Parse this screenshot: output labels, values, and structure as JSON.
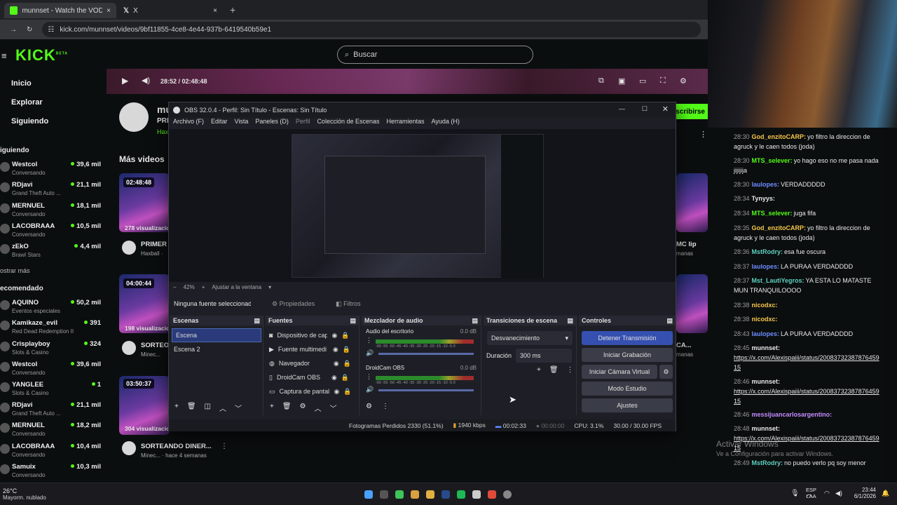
{
  "browser": {
    "tabs": [
      {
        "title": "munnset - Watch the VOD on k"
      },
      {
        "title": "X"
      }
    ],
    "url": "kick.com/munnset/videos/9bf11855-4ce8-4e44-937b-6419540b59e1"
  },
  "site": {
    "logo": "KICK",
    "logo_sup": "BETA",
    "search_placeholder": "Buscar",
    "nav": [
      {
        "label": "Inicio"
      },
      {
        "label": "Explorar"
      },
      {
        "label": "Siguiendo"
      }
    ],
    "following_header": "iguiendo",
    "show_more": "ostrar más",
    "recommended_header": "ecomendado",
    "following": [
      {
        "name": "Westcol",
        "category": "Conversando",
        "viewers": "39,6 mil"
      },
      {
        "name": "RDjavi",
        "category": "Grand Theft Auto ...",
        "viewers": "21,1 mil"
      },
      {
        "name": "MERNUEL",
        "category": "Conversando",
        "viewers": "18,1 mil"
      },
      {
        "name": "LACOBRAAA",
        "category": "Conversando",
        "viewers": "10,5 mil"
      },
      {
        "name": "zEkO",
        "category": "Brawl Stars",
        "viewers": "4,4 mil"
      }
    ],
    "recommended": [
      {
        "name": "AQUINO",
        "category": "Eventos especiales",
        "viewers": "50,2 mil"
      },
      {
        "name": "Kamikaze_evil",
        "category": "Red Dead Redemption II",
        "viewers": "391"
      },
      {
        "name": "Crisplayboy",
        "category": "Slots & Casino",
        "viewers": "324"
      },
      {
        "name": "Westcol",
        "category": "Conversando",
        "viewers": "39,6 mil"
      },
      {
        "name": "YANGLEE",
        "category": "Slots & Casino",
        "viewers": "1"
      },
      {
        "name": "RDjavi",
        "category": "Grand Theft Auto ...",
        "viewers": "21,1 mil"
      },
      {
        "name": "MERNUEL",
        "category": "Conversando",
        "viewers": "18,2 mil"
      },
      {
        "name": "LACOBRAAA",
        "category": "Conversando",
        "viewers": "10,4 mil"
      },
      {
        "name": "Samuix",
        "category": "Conversando",
        "viewers": "10,3 mil"
      }
    ],
    "player_time": "28:52 / 02:48:48",
    "channel_short": "mu",
    "channel_line2": "PRI",
    "channel_line3": "Hax",
    "subscribe_label": "scribirse",
    "more_videos": "Más videos",
    "videos": [
      {
        "duration": "02:48:48",
        "views": "278 visualizacio",
        "title": "PRIMER S",
        "meta": "Haxball ·"
      },
      {
        "duration": "04:00:44",
        "views": "198 visualizacio",
        "title": "SORTEO",
        "meta": "Minec..."
      },
      {
        "duration": "03:50:37",
        "views": "304 visualizacio",
        "title": "SORTEANDO DINER...",
        "meta": "Minec... · hace 4 semanas"
      }
    ],
    "right_thumbs": [
      {
        "title": "MC lip",
        "meta": "manas"
      },
      {
        "title": "CA...",
        "meta": "manas"
      }
    ]
  },
  "chat": {
    "messages": [
      {
        "time": "28:30",
        "user": "God_enzitoCARP:",
        "color": "#f7c64a",
        "text": "yo filtro la direccion de agruck y le caen todos (joda)"
      },
      {
        "time": "28:30",
        "user": "MTS_selever:",
        "color": "#53fc18",
        "text": "yo hago eso no me pasa nada jijijija"
      },
      {
        "time": "28:30",
        "user": "laulopes:",
        "color": "#6e8cff",
        "text": "VERDADDDDD"
      },
      {
        "time": "28:34",
        "user": "Tynyys:",
        "color": "#e8e8e8",
        "text": ""
      },
      {
        "time": "28:34",
        "user": "MTS_selever:",
        "color": "#53fc18",
        "text": "juga fifa"
      },
      {
        "time": "28:35",
        "user": "God_enzitoCARP:",
        "color": "#f7c64a",
        "text": "yo filtro la direccion de agruck y le caen todos (joda)"
      },
      {
        "time": "28:36",
        "user": "MstRodry:",
        "color": "#5fd0c0",
        "text": "esa fue oscura"
      },
      {
        "time": "28:37",
        "user": "laulopes:",
        "color": "#6e8cff",
        "text": "LA PURAA VERDADDDD"
      },
      {
        "time": "28:37",
        "user": "Mst_LautiYegros:",
        "color": "#5fd0c0",
        "text": "YA ESTA LO MATASTE MUN TRANQUILOOOO"
      },
      {
        "time": "28:38",
        "user": "nicodxc:",
        "color": "#f7c64a",
        "text": ""
      },
      {
        "time": "28:38",
        "user": "nicodxc:",
        "color": "#f7c64a",
        "text": ""
      },
      {
        "time": "28:43",
        "user": "laulopes:",
        "color": "#6e8cff",
        "text": "LA PURAA VERDADDDD"
      },
      {
        "time": "28:45",
        "user": "munnset:",
        "color": "#e8e8e8",
        "text": "https://x.com/Alexispaiii/status/2008373238787645915"
      },
      {
        "time": "28:46",
        "user": "munnset:",
        "color": "#e8e8e8",
        "text": "https://x.com/Alexispaiii/status/2008373238787645915"
      },
      {
        "time": "28:46",
        "user": "messijuancarlosargentino:",
        "color": "#c58cff",
        "text": ""
      },
      {
        "time": "28:48",
        "user": "munnset:",
        "color": "#e8e8e8",
        "text": "https://x.com/Alexispaiii/status/2008373238787645915"
      },
      {
        "time": "28:49",
        "user": "MstRodry:",
        "color": "#5fd0c0",
        "text": "no puedo verlo pq soy menor"
      }
    ],
    "activate_title": "Activar Windows",
    "activate_sub": "Ve a Configuración para activar Windows."
  },
  "obs": {
    "title": "OBS 32.0.4 - Perfil: Sin Título - Escenas: Sin Título",
    "menu": [
      "Archivo (F)",
      "Editar",
      "Vista",
      "Paneles (D)",
      "Perfil",
      "Colección de Escenas",
      "Herramientas",
      "Ayuda (H)"
    ],
    "zoom": "42%",
    "fit_label": "Ajustar a la ventana",
    "no_source": "Ninguna fuente seleccionad",
    "properties": "Propiedades",
    "filters": "Filtros",
    "docks": {
      "scenes": {
        "title": "Escenas",
        "items": [
          "Escena",
          "Escena 2"
        ]
      },
      "sources": {
        "title": "Fuentes",
        "items": [
          "Dispositivo de cap",
          "Fuente multimedi",
          "Navegador",
          "DroidCam OBS",
          "Captura de pantal"
        ]
      },
      "mixer": {
        "title": "Mezclador de audio",
        "channels": [
          {
            "name": "Audio del escritorio",
            "db": "0.0 dB"
          },
          {
            "name": "DroidCam OBS",
            "db": "0.0 dB"
          }
        ],
        "scale": "-60 -55 -50 -45 -40 -35 -30 -25 -20 -15 -10 -5 0"
      },
      "transitions": {
        "title": "Transiciones de escena",
        "selected": "Desvanecimiento",
        "duration_label": "Duración",
        "duration": "300 ms"
      },
      "controls": {
        "title": "Controles",
        "buttons": [
          "Detener Transmisión",
          "Iniciar Grabación",
          "Iniciar Cámara Virtual",
          "Modo Estudio",
          "Ajustes"
        ]
      }
    },
    "status": {
      "dropped": "Fotogramas Perdidos 2330 (51.1%)",
      "bitrate": "1940 kbps",
      "stream_time": "00:02:33",
      "rec_time": "00:00:00",
      "cpu": "CPU: 3.1%",
      "fps": "30.00 / 30.00 FPS"
    }
  },
  "taskbar": {
    "weather_temp": "26°C",
    "weather_desc": "Mayorm. nublado",
    "lang": "ESP",
    "lang2": "LAA",
    "time": "23:44",
    "date": "6/1/2026"
  }
}
